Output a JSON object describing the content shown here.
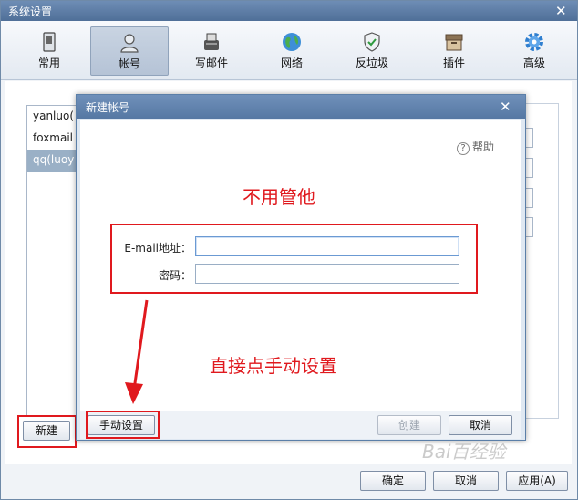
{
  "window": {
    "title": "系统设置"
  },
  "toolbar": {
    "items": [
      {
        "label": "常用",
        "icon": "general-icon"
      },
      {
        "label": "帐号",
        "icon": "user-icon",
        "active": true
      },
      {
        "label": "写邮件",
        "icon": "compose-icon"
      },
      {
        "label": "网络",
        "icon": "globe-icon"
      },
      {
        "label": "反垃圾",
        "icon": "shield-icon"
      },
      {
        "label": "插件",
        "icon": "plugin-box-icon"
      },
      {
        "label": "高级",
        "icon": "gear-icon"
      }
    ]
  },
  "accounts": {
    "items": [
      "yanluo(",
      "foxmail",
      "qq(luoy"
    ],
    "selected_index": 2
  },
  "buttons": {
    "new_label": "新建",
    "ok_label": "确定",
    "cancel_label": "取消",
    "apply_label": "应用(A)"
  },
  "dialog": {
    "title": "新建帐号",
    "help_label": "帮助",
    "email_label": "E-mail地址：",
    "password_label": "密码：",
    "email_value": "",
    "password_value": "",
    "manual_setup_label": "手动设置",
    "create_label": "创建",
    "cancel_label": "取消"
  },
  "annotations": {
    "top_note": "不用管他",
    "bottom_note": "直接点手动设置"
  },
  "watermark": "Bai百经验",
  "colors": {
    "annotation_red": "#e0191e",
    "title_blue": "#5678a3",
    "selected_row": "#9ab0c6"
  }
}
